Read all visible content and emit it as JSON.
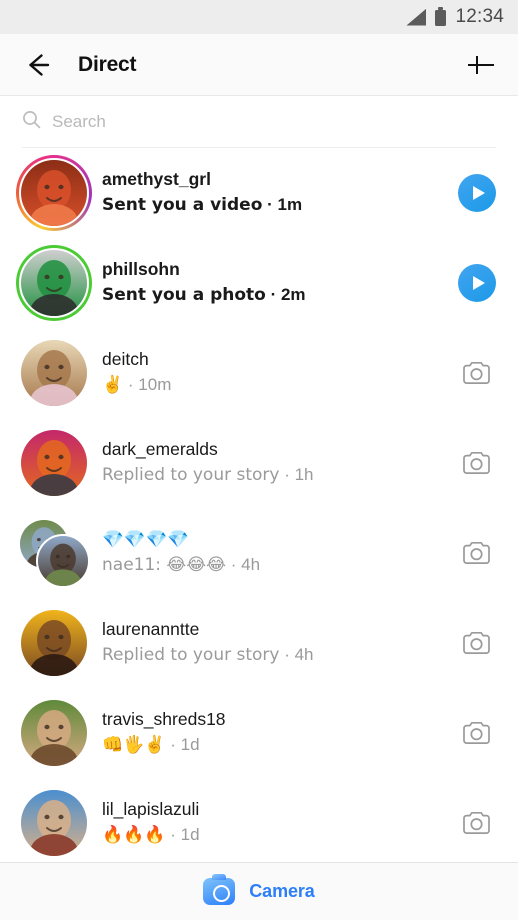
{
  "status_bar": {
    "time": "12:34",
    "signal_icon": "signal-triangle-icon",
    "battery_icon": "battery-full-icon"
  },
  "header": {
    "back_icon": "arrow-left-icon",
    "title": "Direct",
    "new_message_icon": "plus-icon"
  },
  "search": {
    "icon": "search-icon",
    "placeholder": "Search",
    "value": ""
  },
  "colors": {
    "accent_blue": "#2d7ff9",
    "play_blue": "#1c9ae8",
    "close_friends_green": "#4ccb36",
    "story_gradient_start": "#f9ce34",
    "story_gradient_mid": "#e8308a",
    "story_gradient_end": "#9b36b7",
    "muted_text": "#9a9a9a",
    "primary_text": "#1a1a1a"
  },
  "threads": [
    {
      "username": "amethyst_grl",
      "preview": "Sent you a video",
      "timestamp": "1m",
      "unread": true,
      "ring": "gradient",
      "action_icon": "play-button-icon",
      "avatar_type": "single",
      "avatar_colors": [
        "#8c2d16",
        "#d8502a",
        "#f07a4a"
      ]
    },
    {
      "username": "phillsohn",
      "preview": "Sent you a photo",
      "timestamp": "2m",
      "unread": true,
      "ring": "green",
      "action_icon": "play-button-icon",
      "avatar_type": "single",
      "avatar_colors": [
        "#cfcfcf",
        "#1f8f3e",
        "#2f2f2f"
      ]
    },
    {
      "username": "deitch",
      "preview": "✌️",
      "timestamp": "10m",
      "unread": false,
      "ring": "none",
      "action_icon": "camera-icon",
      "avatar_type": "single",
      "avatar_colors": [
        "#e8d7b6",
        "#a6784c",
        "#e7c3cf"
      ]
    },
    {
      "username": "dark_emeralds",
      "preview": "Replied to your story",
      "timestamp": "1h",
      "unread": false,
      "ring": "none",
      "action_icon": "camera-icon",
      "avatar_type": "single",
      "avatar_colors": [
        "#c3286b",
        "#e4691f",
        "#3a3a44"
      ]
    },
    {
      "username": "💎💎💎💎",
      "preview": "nae11: 😂😂😂",
      "timestamp": "4h",
      "unread": false,
      "ring": "none",
      "action_icon": "camera-icon",
      "avatar_type": "group",
      "avatar_colors": [
        "#6f8a4b",
        "#8fa8c8",
        "#4a3a2e"
      ]
    },
    {
      "username": "laurenanntte",
      "preview": "Replied to your story",
      "timestamp": "4h",
      "unread": false,
      "ring": "none",
      "action_icon": "camera-icon",
      "avatar_type": "single",
      "avatar_colors": [
        "#f0b41c",
        "#7a4a23",
        "#2b1a12"
      ]
    },
    {
      "username": "travis_shreds18",
      "preview": "👊🖐️✌️",
      "timestamp": "1d",
      "unread": false,
      "ring": "none",
      "action_icon": "camera-icon",
      "avatar_type": "single",
      "avatar_colors": [
        "#5f8a3a",
        "#d6a982",
        "#6b4a2c"
      ]
    },
    {
      "username": "lil_lapislazuli",
      "preview": "🔥🔥🔥",
      "timestamp": "1d",
      "unread": false,
      "ring": "none",
      "action_icon": "camera-icon",
      "avatar_type": "single",
      "avatar_colors": [
        "#4a8fcf",
        "#d8b08a",
        "#8a3a2a"
      ]
    }
  ],
  "bottom_bar": {
    "camera_icon": "camera-icon",
    "label": "Camera"
  }
}
